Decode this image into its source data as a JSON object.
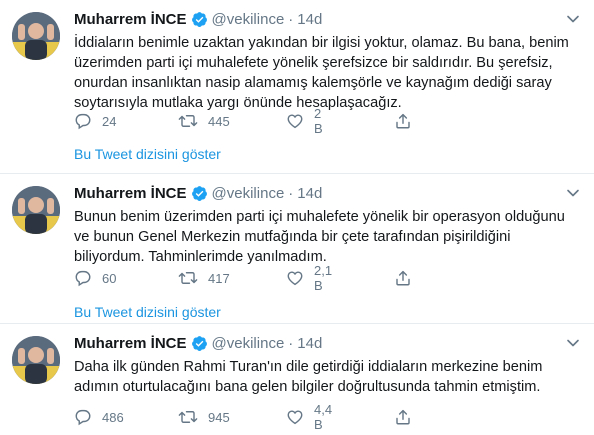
{
  "tweets": [
    {
      "name": "Muharrem İNCE",
      "handle": "@vekilince",
      "separator": "·",
      "time": "14d",
      "text": "İddiaların benimle uzaktan yakından bir ilgisi yoktur, olamaz. Bu bana, benim üzerimden parti içi muhalefete yönelik şerefsizce bir saldırıdır. Bu şerefsiz, onurdan insanlıktan nasip alamamış kalemşörle ve kaynağım dediği saray soytarısıyla mutlaka yargı önünde hesaplaşacağız.",
      "replies": "24",
      "retweets": "445",
      "likes": "2 B",
      "thread_link": "Bu Tweet dizisini göster"
    },
    {
      "name": "Muharrem İNCE",
      "handle": "@vekilince",
      "separator": "·",
      "time": "14d",
      "text": "Bunun benim üzerimden parti içi muhalefete yönelik bir operasyon olduğunu ve bunun Genel Merkezin mutfağında bir çete tarafından pişirildiğini biliyordum. Tahminlerimde yanılmadım.",
      "replies": "60",
      "retweets": "417",
      "likes": "2,1 B",
      "thread_link": "Bu Tweet dizisini göster"
    },
    {
      "name": "Muharrem İNCE",
      "handle": "@vekilince",
      "separator": "·",
      "time": "14d",
      "text": "Daha ilk günden Rahmi Turan'ın dile getirdiği iddiaların merkezine benim adımın oturtulacağını bana gelen bilgiler doğrultusunda tahmin etmiştim.",
      "replies": "486",
      "retweets": "945",
      "likes": "4,4 B"
    }
  ],
  "colors": {
    "text": "#14171a",
    "secondary": "#657786",
    "link": "#1b95e0",
    "verified": "#1da1f2",
    "divider": "#e6ecf0"
  }
}
